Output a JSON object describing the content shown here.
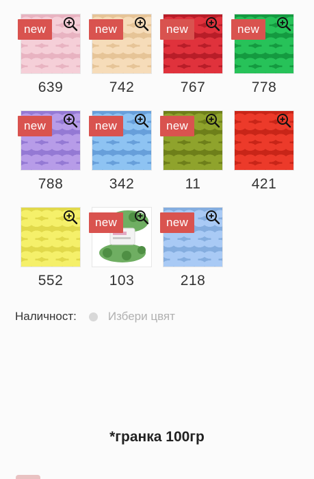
{
  "swatches": [
    {
      "code": "639",
      "color": "#f5cfd8",
      "shade": "#e8b3c1",
      "is_new": true,
      "badge": "new",
      "icon": "zoom-in-icon"
    },
    {
      "code": "742",
      "color": "#f6dcb9",
      "shade": "#e6c497",
      "is_new": true,
      "badge": "new",
      "icon": "zoom-in-icon"
    },
    {
      "code": "767",
      "color": "#e0323c",
      "shade": "#b81d28",
      "is_new": true,
      "badge": "new",
      "icon": "zoom-in-icon"
    },
    {
      "code": "778",
      "color": "#27c259",
      "shade": "#149a40",
      "is_new": true,
      "badge": "new",
      "icon": "zoom-in-icon"
    },
    {
      "code": "788",
      "color": "#b79ce8",
      "shade": "#9479d4",
      "is_new": true,
      "badge": "new",
      "icon": "zoom-in-icon"
    },
    {
      "code": "342",
      "color": "#8ec3f2",
      "shade": "#679fda",
      "is_new": true,
      "badge": "new",
      "icon": "zoom-in-icon"
    },
    {
      "code": "11",
      "color": "#8fa32c",
      "shade": "#6e7f1a",
      "is_new": true,
      "badge": "new",
      "icon": "zoom-in-icon"
    },
    {
      "code": "421",
      "color": "#ec3a2a",
      "shade": "#c82518",
      "is_new": false,
      "badge": "",
      "icon": "zoom-in-icon"
    },
    {
      "code": "552",
      "color": "#f5f06a",
      "shade": "#e1d94a",
      "is_new": false,
      "badge": "",
      "icon": "zoom-in-icon"
    },
    {
      "code": "103",
      "color": "#6fae62",
      "shade": "#4f8f44",
      "is_new": true,
      "badge": "new",
      "icon": "zoom-in-icon"
    },
    {
      "code": "218",
      "color": "#a9caf5",
      "shade": "#84addf",
      "is_new": true,
      "badge": "new",
      "icon": "zoom-in-icon"
    }
  ],
  "availability": {
    "label": "Наличност:",
    "value": "Избери цвят"
  },
  "footnote": "*гранка 100гр",
  "colors": {
    "badge": "#d9534f",
    "text": "#333333",
    "muted": "#b0b0b0"
  }
}
